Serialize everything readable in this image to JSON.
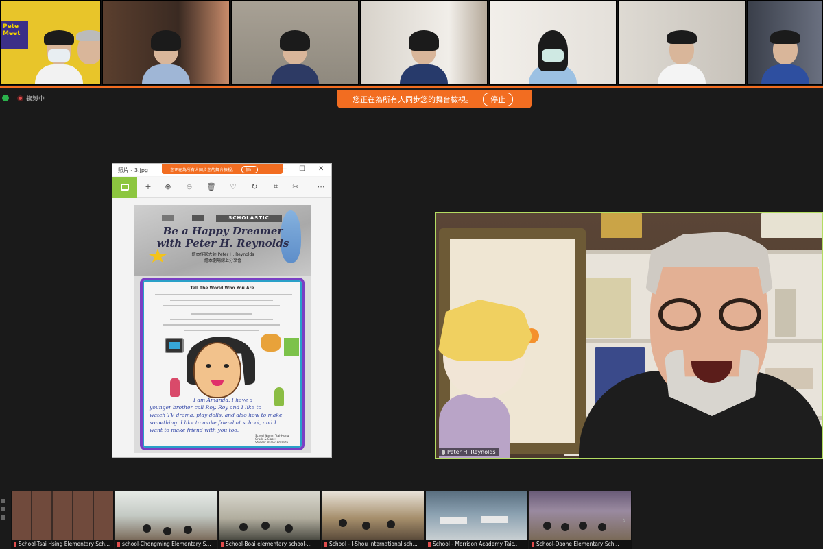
{
  "meeting": {
    "recording_label": "錄製中",
    "share_banner_text": "您正在為所有人同步您的舞台檢視。",
    "stop_label": "停止"
  },
  "top_gallery_tiles": [
    {
      "id": "t1",
      "bg": "#7a6e5e"
    },
    {
      "id": "t2",
      "bg": "#5a4a3d"
    },
    {
      "id": "t3",
      "bg": "#9b9488"
    },
    {
      "id": "t4",
      "bg": "#c9c2b8"
    },
    {
      "id": "t5",
      "bg": "#e9e6e2"
    },
    {
      "id": "t6",
      "bg": "#d8d4cc"
    },
    {
      "id": "t7",
      "bg": "#4a4f58"
    }
  ],
  "top_tile1_sign": "Pete Meet",
  "viewer": {
    "filename": "照片 - 3.jpg",
    "mini_banner_text": "您正在為所有人同步您的舞台檢視。",
    "mini_stop_label": "停止",
    "worksheet": {
      "logo": "SCHOLASTIC",
      "title_line1": "Be a Happy Dreamer",
      "title_line2": "with Peter H. Reynolds",
      "subtitle_line1": "繪本作家大師 Peter H. Reynolds",
      "subtitle_line2": "繪本劇場線上分享會",
      "card_title": "Tell The World Who You Are",
      "handwriting": [
        "I am Amanda. I have a",
        "younger brother call Roy. Roy and I like to",
        "watch TV drama, play dolls, and also how to make",
        "something. I like to make friend at school, and I",
        "want to make friend with you too."
      ],
      "info_box": [
        "School Name: Tsai-Hsing",
        "Grade & Class:",
        "Student Name: Amanda"
      ]
    }
  },
  "speaker": {
    "name": "Peter H. Reynolds",
    "highlight_color": "#b3dc62"
  },
  "bottom_tiles": [
    {
      "label": "School-Tsai Hsing Elementary Sch...",
      "bg": "#6b4a3c"
    },
    {
      "label": "school-Chongming Elementary S...",
      "bg": "#c9cec9"
    },
    {
      "label": "School-Boai elementary school-...",
      "bg": "#b9b6a8"
    },
    {
      "label": "School - I-Shou International sch...",
      "bg": "#a5906d"
    },
    {
      "label": "School - Morrison Academy Taic...",
      "bg": "#7a8fa0"
    },
    {
      "label": "School-Daohe Elementary Sch...",
      "bg": "#8a7a8e"
    }
  ],
  "colors": {
    "accent_orange": "#f26d21",
    "active_speaker": "#b3dc62",
    "background": "#1a1a1a"
  }
}
